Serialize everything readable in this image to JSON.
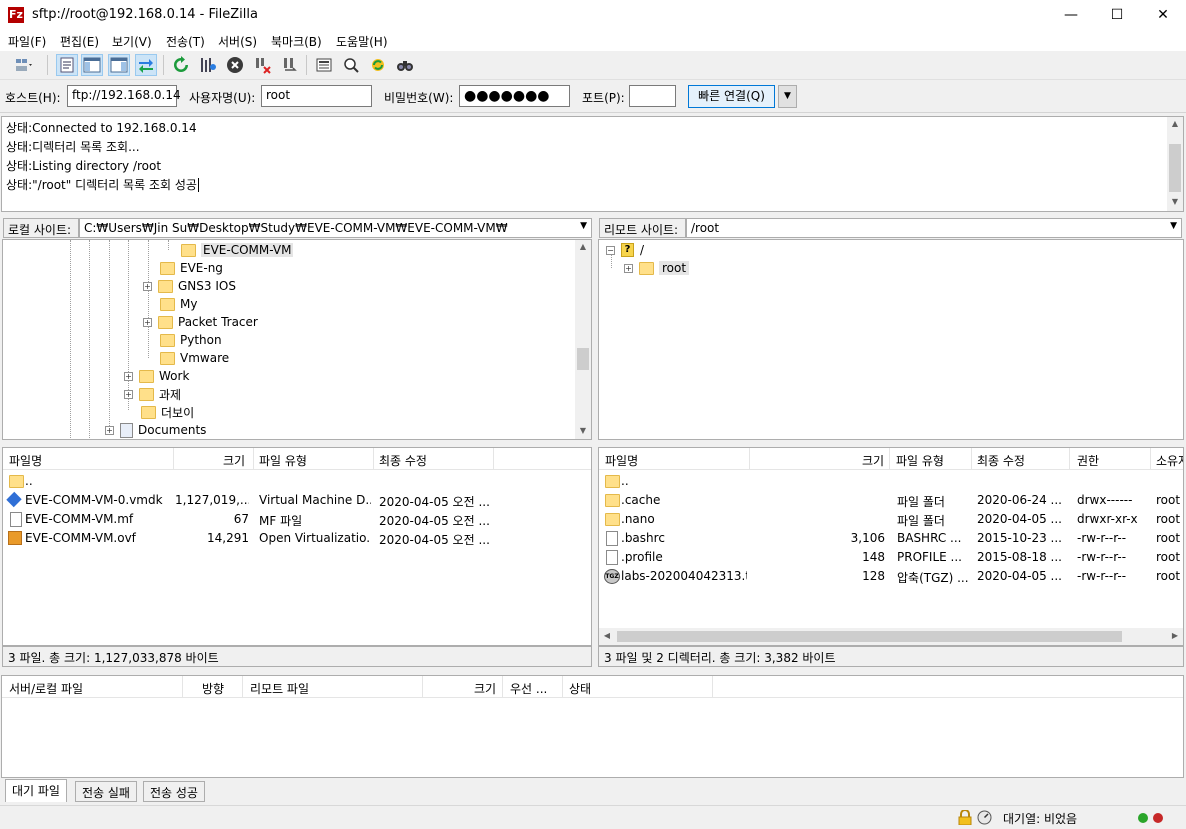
{
  "window": {
    "title": "sftp://root@192.168.0.14 - FileZilla",
    "app_icon": "Fz",
    "minimize": "—",
    "maximize": "☐",
    "close": "✕"
  },
  "menu": [
    "파일(F)",
    "편집(E)",
    "보기(V)",
    "전송(T)",
    "서버(S)",
    "북마크(B)",
    "도움말(H)"
  ],
  "quickconnect": {
    "host_label": "호스트(H):",
    "host_value": "ftp://192.168.0.14",
    "user_label": "사용자명(U):",
    "user_value": "root",
    "pass_label": "비밀번호(W):",
    "pass_value": "●●●●●●●",
    "port_label": "포트(P):",
    "port_value": "",
    "connect_label": "빠른 연결(Q)"
  },
  "log": [
    {
      "prefix": "상태:",
      "text": "Connected to 192.168.0.14"
    },
    {
      "prefix": "상태:",
      "text": "디렉터리 목록 조회..."
    },
    {
      "prefix": "상태:",
      "text": "Listing directory /root"
    },
    {
      "prefix": "상태:",
      "text": "\"/root\" 디렉터리 목록 조회 성공"
    }
  ],
  "local": {
    "site_label": "로컬 사이트:",
    "path": "C:₩Users₩Jin Su₩Desktop₩Study₩EVE-COMM-VM₩EVE-COMM-VM₩",
    "tree": [
      "EVE-COMM-VM",
      "EVE-ng",
      "GNS3 IOS",
      "My",
      "Packet Tracer",
      "Python",
      "Vmware",
      "Work",
      "과제",
      "더보이",
      "Documents"
    ],
    "columns": [
      "파일명",
      "크기",
      "파일 유형",
      "최종 수정"
    ],
    "files": [
      {
        "name": "..",
        "size": "",
        "type": "",
        "modified": ""
      },
      {
        "name": "EVE-COMM-VM-0.vmdk",
        "size": "1,127,019,...",
        "type": "Virtual Machine D...",
        "modified": "2020-04-05 오전 ..."
      },
      {
        "name": "EVE-COMM-VM.mf",
        "size": "67",
        "type": "MF 파일",
        "modified": "2020-04-05 오전 ..."
      },
      {
        "name": "EVE-COMM-VM.ovf",
        "size": "14,291",
        "type": "Open Virtualizatio...",
        "modified": "2020-04-05 오전 ..."
      }
    ],
    "status": "3 파일. 총 크기: 1,127,033,878 바이트"
  },
  "remote": {
    "site_label": "리모트 사이트:",
    "path": "/root",
    "tree": [
      "/",
      "root"
    ],
    "columns": [
      "파일명",
      "크기",
      "파일 유형",
      "최종 수정",
      "권한",
      "소유자"
    ],
    "files": [
      {
        "name": "..",
        "size": "",
        "type": "",
        "modified": "",
        "perm": "",
        "owner": ""
      },
      {
        "name": ".cache",
        "size": "",
        "type": "파일 폴더",
        "modified": "2020-06-24 ...",
        "perm": "drwx------",
        "owner": "root"
      },
      {
        "name": ".nano",
        "size": "",
        "type": "파일 폴더",
        "modified": "2020-04-05 ...",
        "perm": "drwxr-xr-x",
        "owner": "root"
      },
      {
        "name": ".bashrc",
        "size": "3,106",
        "type": "BASHRC ...",
        "modified": "2015-10-23 ...",
        "perm": "-rw-r--r--",
        "owner": "root"
      },
      {
        "name": ".profile",
        "size": "148",
        "type": "PROFILE ...",
        "modified": "2015-08-18 ...",
        "perm": "-rw-r--r--",
        "owner": "root"
      },
      {
        "name": "labs-202004042313.t...",
        "size": "128",
        "type": "압축(TGZ) ...",
        "modified": "2020-04-05 ...",
        "perm": "-rw-r--r--",
        "owner": "root"
      }
    ],
    "status": "3 파일 및 2 디렉터리. 총 크기: 3,382 바이트"
  },
  "queue": {
    "columns": [
      "서버/로컬 파일",
      "방향",
      "리모트 파일",
      "크기",
      "우선 ...",
      "상태"
    ],
    "tabs": [
      "대기 파일",
      "전송 실패",
      "전송 성공"
    ]
  },
  "statusbar": {
    "queue_text": "대기열: 비었음"
  }
}
